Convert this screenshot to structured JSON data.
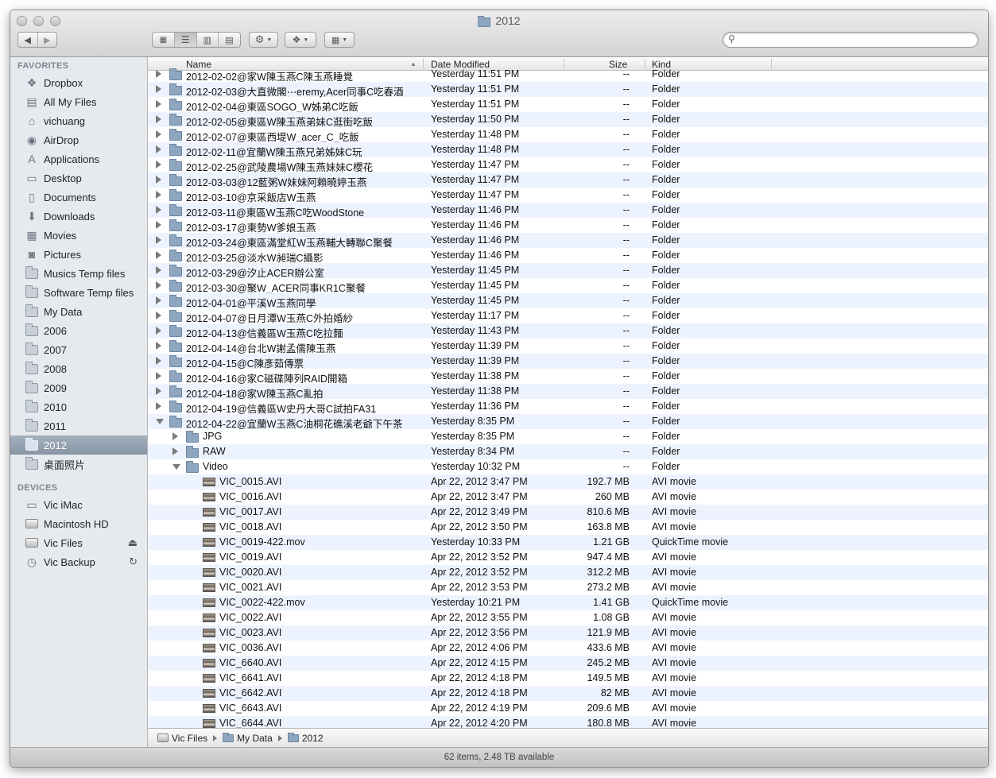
{
  "window": {
    "title": "2012"
  },
  "toolbar": {
    "back_icon": "back-arrow-icon",
    "forward_icon": "forward-arrow-icon",
    "view_icons": [
      "icon-view-icon",
      "list-view-icon",
      "column-view-icon",
      "coverflow-view-icon"
    ],
    "action_icon": "gear-icon",
    "dropbox_icon": "dropbox-icon",
    "arrange_icon": "arrange-icon",
    "search_value": ""
  },
  "sidebar": {
    "favorites_label": "FAVORITES",
    "favorites": [
      {
        "label": "Dropbox",
        "icon": "dropbox-icon"
      },
      {
        "label": "All My Files",
        "icon": "all-files-icon"
      },
      {
        "label": "vichuang",
        "icon": "home-icon"
      },
      {
        "label": "AirDrop",
        "icon": "airdrop-icon"
      },
      {
        "label": "Applications",
        "icon": "applications-icon"
      },
      {
        "label": "Desktop",
        "icon": "desktop-icon"
      },
      {
        "label": "Documents",
        "icon": "documents-icon"
      },
      {
        "label": "Downloads",
        "icon": "downloads-icon"
      },
      {
        "label": "Movies",
        "icon": "movies-icon"
      },
      {
        "label": "Pictures",
        "icon": "pictures-icon"
      },
      {
        "label": "Musics Temp files",
        "icon": "folder-icon"
      },
      {
        "label": "Software Temp files",
        "icon": "folder-icon"
      },
      {
        "label": "My Data",
        "icon": "folder-icon"
      },
      {
        "label": "2006",
        "icon": "folder-icon"
      },
      {
        "label": "2007",
        "icon": "folder-icon"
      },
      {
        "label": "2008",
        "icon": "folder-icon"
      },
      {
        "label": "2009",
        "icon": "folder-icon"
      },
      {
        "label": "2010",
        "icon": "folder-icon"
      },
      {
        "label": "2011",
        "icon": "folder-icon"
      },
      {
        "label": "2012",
        "icon": "folder-icon",
        "selected": true
      },
      {
        "label": "桌面照片",
        "icon": "folder-icon"
      }
    ],
    "devices_label": "DEVICES",
    "devices": [
      {
        "label": "Vic iMac",
        "icon": "imac-icon"
      },
      {
        "label": "Macintosh HD",
        "icon": "hard-drive-icon"
      },
      {
        "label": "Vic Files",
        "icon": "external-drive-icon",
        "right": "⏏",
        "right_icon": "eject-icon"
      },
      {
        "label": "Vic Backup",
        "icon": "time-machine-icon",
        "right": "↻",
        "right_icon": "sync-icon"
      }
    ]
  },
  "columns": {
    "name": "Name",
    "date": "Date Modified",
    "size": "Size",
    "kind": "Kind"
  },
  "rows": [
    {
      "indent": 0,
      "tri": "closed",
      "icon": "folder",
      "name": "2012-02-02@家W陳玉燕C陳玉燕睡覺",
      "date": "Yesterday 11:51 PM",
      "size": "--",
      "kind": "Folder"
    },
    {
      "indent": 0,
      "tri": "closed",
      "icon": "folder",
      "name": "2012-02-03@大直微閣⋯eremy,Acer同事C吃春酒",
      "date": "Yesterday 11:51 PM",
      "size": "--",
      "kind": "Folder"
    },
    {
      "indent": 0,
      "tri": "closed",
      "icon": "folder",
      "name": "2012-02-04@東區SOGO_W姊弟C吃飯",
      "date": "Yesterday 11:51 PM",
      "size": "--",
      "kind": "Folder"
    },
    {
      "indent": 0,
      "tri": "closed",
      "icon": "folder",
      "name": "2012-02-05@東區W陳玉燕弟妹C逛街吃飯",
      "date": "Yesterday 11:50 PM",
      "size": "--",
      "kind": "Folder"
    },
    {
      "indent": 0,
      "tri": "closed",
      "icon": "folder",
      "name": "2012-02-07@東區西堤W_acer_C_吃飯",
      "date": "Yesterday 11:48 PM",
      "size": "--",
      "kind": "Folder"
    },
    {
      "indent": 0,
      "tri": "closed",
      "icon": "folder",
      "name": "2012-02-11@宜蘭W陳玉燕兄弟姊妹C玩",
      "date": "Yesterday 11:48 PM",
      "size": "--",
      "kind": "Folder"
    },
    {
      "indent": 0,
      "tri": "closed",
      "icon": "folder",
      "name": "2012-02-25@武陵農場W陳玉燕妹妹C櫻花",
      "date": "Yesterday 11:47 PM",
      "size": "--",
      "kind": "Folder"
    },
    {
      "indent": 0,
      "tri": "closed",
      "icon": "folder",
      "name": "2012-03-03@12藍粥W妹妹阿賴曉婷玉燕",
      "date": "Yesterday 11:47 PM",
      "size": "--",
      "kind": "Folder"
    },
    {
      "indent": 0,
      "tri": "closed",
      "icon": "folder",
      "name": "2012-03-10@京采飯店W玉燕",
      "date": "Yesterday 11:47 PM",
      "size": "--",
      "kind": "Folder"
    },
    {
      "indent": 0,
      "tri": "closed",
      "icon": "folder",
      "name": "2012-03-11@東區W玉燕C吃WoodStone",
      "date": "Yesterday 11:46 PM",
      "size": "--",
      "kind": "Folder"
    },
    {
      "indent": 0,
      "tri": "closed",
      "icon": "folder",
      "name": "2012-03-17@東勢W爹娘玉燕",
      "date": "Yesterday 11:46 PM",
      "size": "--",
      "kind": "Folder"
    },
    {
      "indent": 0,
      "tri": "closed",
      "icon": "folder",
      "name": "2012-03-24@東區滿堂紅W玉燕輔大轉聯C聚餐",
      "date": "Yesterday 11:46 PM",
      "size": "--",
      "kind": "Folder"
    },
    {
      "indent": 0,
      "tri": "closed",
      "icon": "folder",
      "name": "2012-03-25@淡水W昶瑞C攝影",
      "date": "Yesterday 11:46 PM",
      "size": "--",
      "kind": "Folder"
    },
    {
      "indent": 0,
      "tri": "closed",
      "icon": "folder",
      "name": "2012-03-29@汐止ACER辦公室",
      "date": "Yesterday 11:45 PM",
      "size": "--",
      "kind": "Folder"
    },
    {
      "indent": 0,
      "tri": "closed",
      "icon": "folder",
      "name": "2012-03-30@聚W_ACER同事KR1C聚餐",
      "date": "Yesterday 11:45 PM",
      "size": "--",
      "kind": "Folder"
    },
    {
      "indent": 0,
      "tri": "closed",
      "icon": "folder",
      "name": "2012-04-01@平溪W玉燕同學",
      "date": "Yesterday 11:45 PM",
      "size": "--",
      "kind": "Folder"
    },
    {
      "indent": 0,
      "tri": "closed",
      "icon": "folder",
      "name": "2012-04-07@日月潭W玉燕C外拍婚紗",
      "date": "Yesterday 11:17 PM",
      "size": "--",
      "kind": "Folder"
    },
    {
      "indent": 0,
      "tri": "closed",
      "icon": "folder",
      "name": "2012-04-13@信義區W玉燕C吃拉麵",
      "date": "Yesterday 11:43 PM",
      "size": "--",
      "kind": "Folder"
    },
    {
      "indent": 0,
      "tri": "closed",
      "icon": "folder",
      "name": "2012-04-14@台北W謝孟儒陳玉燕",
      "date": "Yesterday 11:39 PM",
      "size": "--",
      "kind": "Folder"
    },
    {
      "indent": 0,
      "tri": "closed",
      "icon": "folder",
      "name": "2012-04-15@C陳彥茹傳票",
      "date": "Yesterday 11:39 PM",
      "size": "--",
      "kind": "Folder"
    },
    {
      "indent": 0,
      "tri": "closed",
      "icon": "folder",
      "name": "2012-04-16@家C磁碟陣列RAID開箱",
      "date": "Yesterday 11:38 PM",
      "size": "--",
      "kind": "Folder"
    },
    {
      "indent": 0,
      "tri": "closed",
      "icon": "folder",
      "name": "2012-04-18@家W陳玉燕C亂拍",
      "date": "Yesterday 11:38 PM",
      "size": "--",
      "kind": "Folder"
    },
    {
      "indent": 0,
      "tri": "closed",
      "icon": "folder",
      "name": "2012-04-19@信義區W史丹大哥C試拍FA31",
      "date": "Yesterday 11:36 PM",
      "size": "--",
      "kind": "Folder"
    },
    {
      "indent": 0,
      "tri": "open",
      "icon": "folder",
      "name": "2012-04-22@宜蘭W玉燕C油桐花礁溪老爺下午茶",
      "date": "Yesterday 8:35 PM",
      "size": "--",
      "kind": "Folder"
    },
    {
      "indent": 1,
      "tri": "closed",
      "icon": "folder",
      "name": "JPG",
      "date": "Yesterday 8:35 PM",
      "size": "--",
      "kind": "Folder"
    },
    {
      "indent": 1,
      "tri": "closed",
      "icon": "folder",
      "name": "RAW",
      "date": "Yesterday 8:34 PM",
      "size": "--",
      "kind": "Folder"
    },
    {
      "indent": 1,
      "tri": "open",
      "icon": "folder",
      "name": "Video",
      "date": "Yesterday 10:32 PM",
      "size": "--",
      "kind": "Folder"
    },
    {
      "indent": 2,
      "tri": "",
      "icon": "movie",
      "name": "VIC_0015.AVI",
      "date": "Apr 22, 2012 3:47 PM",
      "size": "192.7 MB",
      "kind": "AVI movie"
    },
    {
      "indent": 2,
      "tri": "",
      "icon": "movie",
      "name": "VIC_0016.AVI",
      "date": "Apr 22, 2012 3:47 PM",
      "size": "260 MB",
      "kind": "AVI movie"
    },
    {
      "indent": 2,
      "tri": "",
      "icon": "movie",
      "name": "VIC_0017.AVI",
      "date": "Apr 22, 2012 3:49 PM",
      "size": "810.6 MB",
      "kind": "AVI movie"
    },
    {
      "indent": 2,
      "tri": "",
      "icon": "movie",
      "name": "VIC_0018.AVI",
      "date": "Apr 22, 2012 3:50 PM",
      "size": "163.8 MB",
      "kind": "AVI movie"
    },
    {
      "indent": 2,
      "tri": "",
      "icon": "movie",
      "name": "VIC_0019-422.mov",
      "date": "Yesterday 10:33 PM",
      "size": "1.21 GB",
      "kind": "QuickTime movie"
    },
    {
      "indent": 2,
      "tri": "",
      "icon": "movie",
      "name": "VIC_0019.AVI",
      "date": "Apr 22, 2012 3:52 PM",
      "size": "947.4 MB",
      "kind": "AVI movie"
    },
    {
      "indent": 2,
      "tri": "",
      "icon": "movie",
      "name": "VIC_0020.AVI",
      "date": "Apr 22, 2012 3:52 PM",
      "size": "312.2 MB",
      "kind": "AVI movie"
    },
    {
      "indent": 2,
      "tri": "",
      "icon": "movie",
      "name": "VIC_0021.AVI",
      "date": "Apr 22, 2012 3:53 PM",
      "size": "273.2 MB",
      "kind": "AVI movie"
    },
    {
      "indent": 2,
      "tri": "",
      "icon": "movie",
      "name": "VIC_0022-422.mov",
      "date": "Yesterday 10:21 PM",
      "size": "1.41 GB",
      "kind": "QuickTime movie"
    },
    {
      "indent": 2,
      "tri": "",
      "icon": "movie",
      "name": "VIC_0022.AVI",
      "date": "Apr 22, 2012 3:55 PM",
      "size": "1.08 GB",
      "kind": "AVI movie"
    },
    {
      "indent": 2,
      "tri": "",
      "icon": "movie",
      "name": "VIC_0023.AVI",
      "date": "Apr 22, 2012 3:56 PM",
      "size": "121.9 MB",
      "kind": "AVI movie"
    },
    {
      "indent": 2,
      "tri": "",
      "icon": "movie",
      "name": "VIC_0036.AVI",
      "date": "Apr 22, 2012 4:06 PM",
      "size": "433.6 MB",
      "kind": "AVI movie"
    },
    {
      "indent": 2,
      "tri": "",
      "icon": "movie",
      "name": "VIC_6640.AVI",
      "date": "Apr 22, 2012 4:15 PM",
      "size": "245.2 MB",
      "kind": "AVI movie"
    },
    {
      "indent": 2,
      "tri": "",
      "icon": "movie",
      "name": "VIC_6641.AVI",
      "date": "Apr 22, 2012 4:18 PM",
      "size": "149.5 MB",
      "kind": "AVI movie"
    },
    {
      "indent": 2,
      "tri": "",
      "icon": "movie",
      "name": "VIC_6642.AVI",
      "date": "Apr 22, 2012 4:18 PM",
      "size": "82 MB",
      "kind": "AVI movie"
    },
    {
      "indent": 2,
      "tri": "",
      "icon": "movie",
      "name": "VIC_6643.AVI",
      "date": "Apr 22, 2012 4:19 PM",
      "size": "209.6 MB",
      "kind": "AVI movie"
    },
    {
      "indent": 2,
      "tri": "",
      "icon": "movie",
      "name": "VIC_6644.AVI",
      "date": "Apr 22, 2012 4:20 PM",
      "size": "180.8 MB",
      "kind": "AVI movie"
    }
  ],
  "pathbar": [
    {
      "label": "Vic Files",
      "icon": "external-drive-icon"
    },
    {
      "label": "My Data",
      "icon": "folder-icon"
    },
    {
      "label": "2012",
      "icon": "folder-icon"
    }
  ],
  "status": "62 items, 2.48 TB available",
  "colors": {
    "selection": "#8795a6",
    "alt_row": "#edf3fe",
    "folder": "#8ea6bf"
  }
}
